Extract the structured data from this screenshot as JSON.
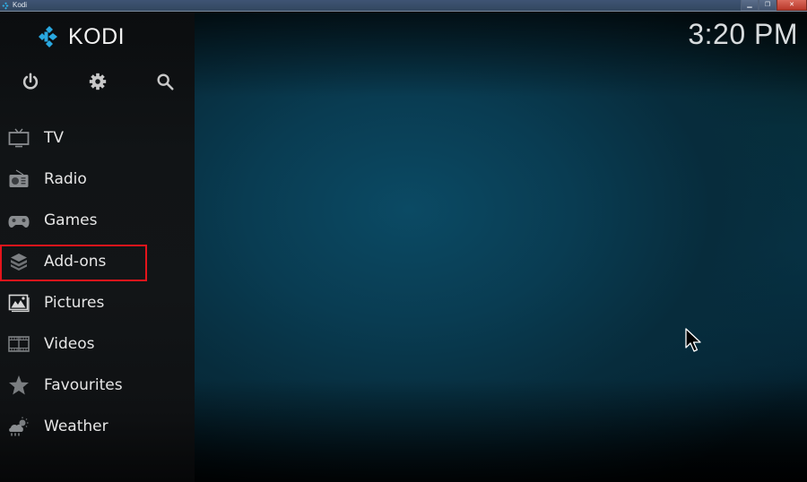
{
  "window": {
    "title": "Kodi",
    "controls": [
      {
        "name": "minimize",
        "glyph": "▁"
      },
      {
        "name": "restore",
        "glyph": "❐"
      },
      {
        "name": "close",
        "glyph": "✕"
      }
    ]
  },
  "header": {
    "logo_text": "KODI",
    "clock": "3:20 PM"
  },
  "top_actions": [
    {
      "name": "power",
      "icon": "power-icon"
    },
    {
      "name": "settings",
      "icon": "gear-icon"
    },
    {
      "name": "search",
      "icon": "search-icon"
    }
  ],
  "menu": {
    "items": [
      {
        "label": "TV",
        "icon": "tv-icon"
      },
      {
        "label": "Radio",
        "icon": "radio-icon"
      },
      {
        "label": "Games",
        "icon": "gamepad-icon"
      },
      {
        "label": "Add-ons",
        "icon": "addons-box-icon",
        "highlighted": true
      },
      {
        "label": "Pictures",
        "icon": "pictures-icon"
      },
      {
        "label": "Videos",
        "icon": "film-icon"
      },
      {
        "label": "Favourites",
        "icon": "star-icon"
      },
      {
        "label": "Weather",
        "icon": "weather-icon"
      }
    ]
  },
  "colors": {
    "brand_accent": "#29a8e0",
    "highlight_border": "#e4141b",
    "sidebar_bg": "#121517",
    "main_bg": "#0b4a64",
    "text": "#e6e6e6",
    "icon_gray": "#8a8d90"
  }
}
